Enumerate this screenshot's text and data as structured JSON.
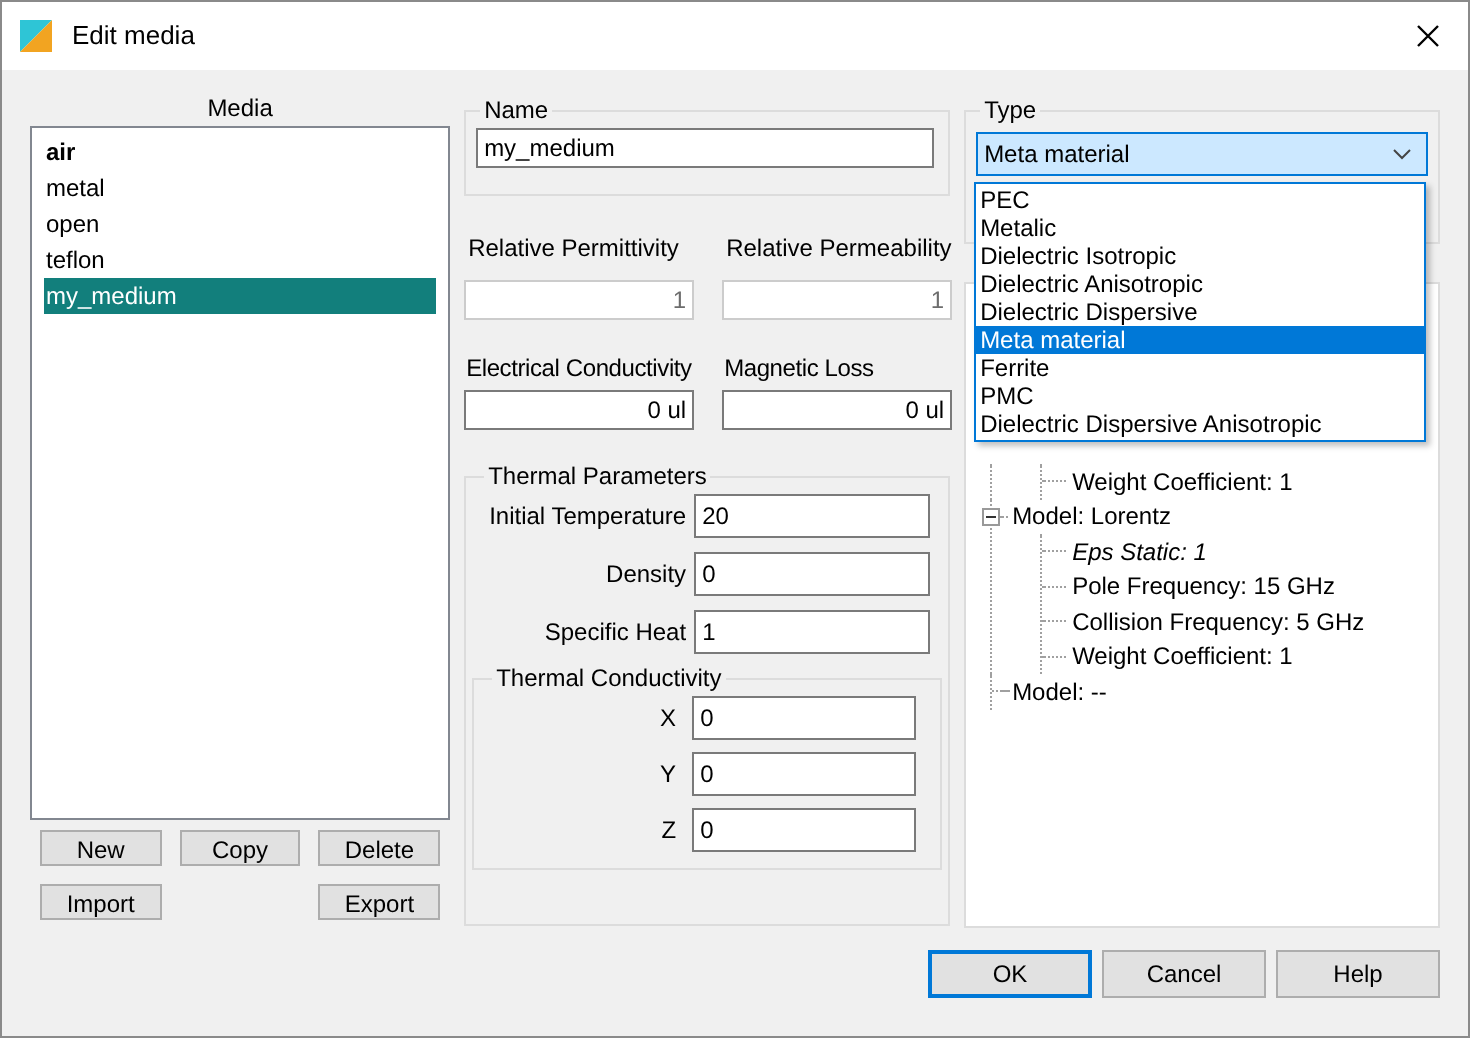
{
  "window": {
    "title": "Edit media"
  },
  "media": {
    "label": "Media",
    "items": [
      {
        "label": "air",
        "bold": true,
        "selected": false
      },
      {
        "label": "metal",
        "bold": false,
        "selected": false
      },
      {
        "label": "open",
        "bold": false,
        "selected": false
      },
      {
        "label": "teflon",
        "bold": false,
        "selected": false
      },
      {
        "label": "my_medium",
        "bold": false,
        "selected": true
      }
    ],
    "buttons": [
      "New",
      "Copy",
      "Delete",
      "Import",
      "Export"
    ]
  },
  "name": {
    "label": "Name",
    "value": "my_medium"
  },
  "properties": [
    {
      "label": "Relative Permittivity",
      "value": "1",
      "disabled": true
    },
    {
      "label": "Relative Permeability",
      "value": "1",
      "disabled": true
    },
    {
      "label": "Electrical Conductivity",
      "value": "0 ul",
      "disabled": false
    },
    {
      "label": "Magnetic Loss",
      "value": "0 ul",
      "disabled": false
    }
  ],
  "thermal": {
    "label": "Thermal Parameters",
    "fields": [
      {
        "label": "Initial Temperature",
        "value": "20"
      },
      {
        "label": "Density",
        "value": "0"
      },
      {
        "label": "Specific Heat",
        "value": "1"
      }
    ],
    "conductivity": {
      "label": "Thermal Conductivity",
      "fields": [
        {
          "label": "X",
          "value": "0"
        },
        {
          "label": "Y",
          "value": "0"
        },
        {
          "label": "Z",
          "value": "0"
        }
      ]
    }
  },
  "type": {
    "label": "Type",
    "value": "Meta material",
    "open": true,
    "options": [
      {
        "label": "PEC",
        "selected": false
      },
      {
        "label": "Metalic",
        "selected": false
      },
      {
        "label": "Dielectric Isotropic",
        "selected": false
      },
      {
        "label": "Dielectric Anisotropic",
        "selected": false
      },
      {
        "label": "Dielectric Dispersive",
        "selected": false
      },
      {
        "label": "Meta material",
        "selected": true
      },
      {
        "label": "Ferrite",
        "selected": false
      },
      {
        "label": "PMC",
        "selected": false
      },
      {
        "label": "Dielectric Dispersive Anisotropic",
        "selected": false
      }
    ]
  },
  "tree": [
    {
      "children": [
        {
          "label": "Weight Coefficient: 1",
          "italic": false
        }
      ]
    },
    {
      "label": "Model: Lorentz",
      "expanded": true,
      "children": [
        {
          "label": "Eps Static: 1",
          "italic": true
        },
        {
          "label": "Pole Frequency: 15 GHz",
          "italic": false
        },
        {
          "label": "Collision Frequency: 5 GHz",
          "italic": false
        },
        {
          "label": "Weight Coefficient: 1",
          "italic": false
        }
      ]
    },
    {
      "label": "Model: --"
    }
  ],
  "buttons": [
    {
      "label": "OK",
      "default": true
    },
    {
      "label": "Cancel",
      "default": false
    },
    {
      "label": "Help",
      "default": false
    }
  ]
}
